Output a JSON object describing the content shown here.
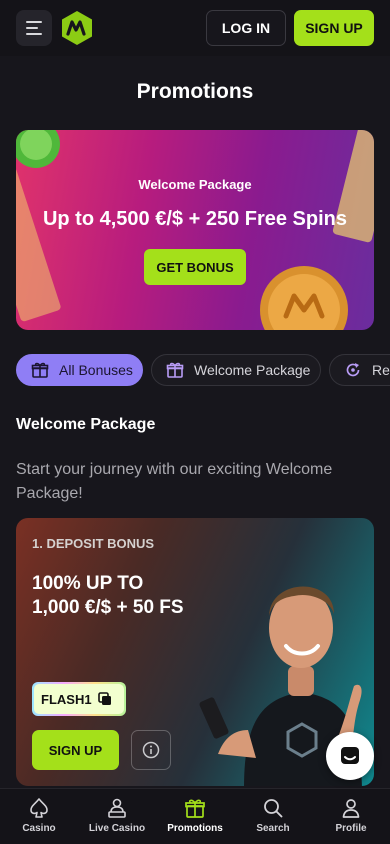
{
  "header": {
    "login_label": "LOG IN",
    "signup_label": "SIGN UP"
  },
  "page_title": "Promotions",
  "hero": {
    "kicker": "Welcome Package",
    "headline": "Up to 4,500 €/$ + 250 Free Spins",
    "cta_label": "GET BONUS"
  },
  "filters": [
    {
      "label": "All Bonuses",
      "icon": "gift-icon",
      "active": true
    },
    {
      "label": "Welcome Package",
      "icon": "gift-box-icon",
      "active": false
    },
    {
      "label": "Rel",
      "icon": "reload-icon",
      "active": false
    }
  ],
  "section": {
    "title": "Welcome Package",
    "description": "Start your journey with our exciting Welcome Package!"
  },
  "deposit_card": {
    "kicker": "1. DEPOSIT BONUS",
    "title_line1": "100% UP TO",
    "title_line2": "1,000 €/$ + 50 FS",
    "promo_code": "FLASH1",
    "signup_label": "SIGN UP"
  },
  "bottom_nav": [
    {
      "label": "Casino",
      "icon": "spade-icon"
    },
    {
      "label": "Live Casino",
      "icon": "dealer-icon"
    },
    {
      "label": "Promotions",
      "icon": "gift-icon",
      "active": true
    },
    {
      "label": "Search",
      "icon": "search-icon"
    },
    {
      "label": "Profile",
      "icon": "user-icon"
    }
  ],
  "colors": {
    "accent": "#a4e01a",
    "chip_active": "#8f7ef5",
    "background": "#17161c"
  }
}
